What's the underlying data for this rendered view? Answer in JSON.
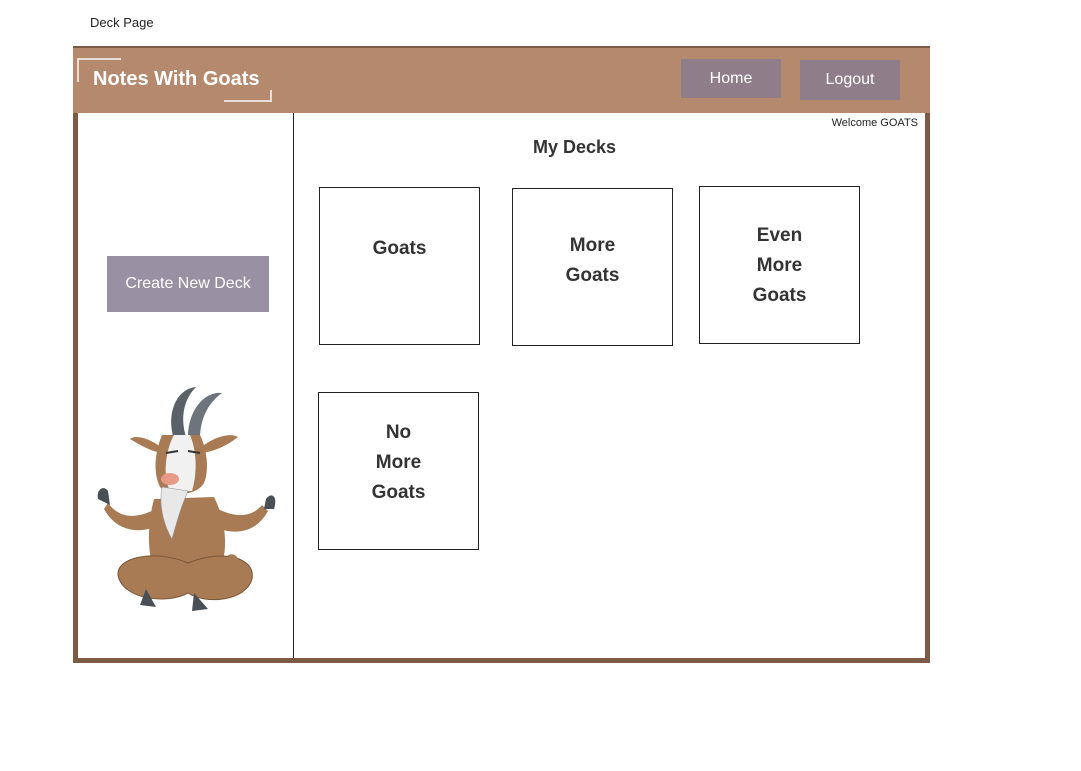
{
  "page_label": "Deck Page",
  "header": {
    "app_title": "Notes With Goats",
    "home_label": "Home",
    "logout_label": "Logout"
  },
  "welcome_text": "Welcome GOATS",
  "sidebar": {
    "create_label": "Create New Deck",
    "mascot_icon": "meditating-goat-illustration"
  },
  "main": {
    "title": "My Decks",
    "decks": [
      {
        "title": "Goats"
      },
      {
        "title": "More\nGoats"
      },
      {
        "title": "Even\n More\nGoats"
      },
      {
        "title": "No\n More\nGoats"
      }
    ]
  },
  "colors": {
    "frame": "#7d5a44",
    "header": "#b5896d",
    "nav_button": "#8f7e89",
    "create_button": "#9a90a3"
  }
}
